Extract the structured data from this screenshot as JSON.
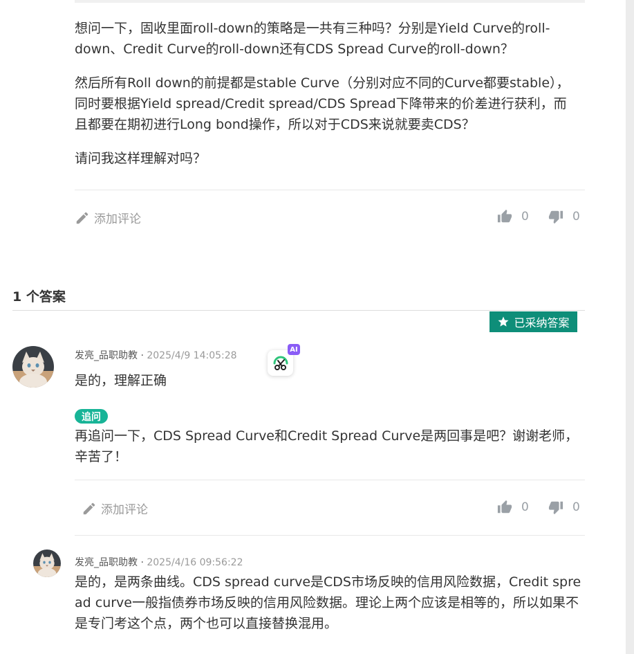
{
  "question": {
    "paragraphs": [
      "想问一下，固收里面roll-down的策略是一共有三种吗？分别是Yield Curve的roll-down、Credit Curve的roll-down还有CDS Spread Curve的roll-down？",
      "然后所有Roll down的前提都是stable Curve（分别对应不同的Curve都要stable），同时要根据Yield spread/Credit spread/CDS Spread下降带来的价差进行获利，而且都要在期初进行Long bond操作，所以对于CDS来说就要卖CDS？",
      "请问我这样理解对吗？"
    ],
    "actions": {
      "comment_label": "添加评论",
      "likes": "0",
      "dislikes": "0"
    }
  },
  "answers_heading": "1 个答案",
  "accepted_badge": "已采纳答案",
  "answer": {
    "author": "发亮_品职助教",
    "separator": " · ",
    "time": "2025/4/9 14:05:28",
    "text": "是的，理解正确",
    "followup_tag": "追问",
    "followup_text": " 再追问一下，CDS Spread Curve和Credit Spread Curve是两回事是吧？谢谢老师，辛苦了！",
    "actions": {
      "comment_label": "添加评论",
      "likes": "0",
      "dislikes": "0"
    }
  },
  "reply": {
    "author": "发亮_品职助教",
    "separator": " · ",
    "time": "2025/4/16 09:56:22",
    "text": " 是的，是两条曲线。CDS spread curve是CDS市场反映的信用风险数据，Credit spread curve一般指债券市场反映的信用风险数据。理论上两个应该是相等的，所以如果不是专门考这个点，两个也可以直接替换混用。"
  },
  "ai_tool": {
    "badge": "AI",
    "icon": "scissors-icon"
  },
  "colors": {
    "accent": "#0e8e79",
    "tag": "#18b497",
    "ai": "#8a5cf6"
  }
}
